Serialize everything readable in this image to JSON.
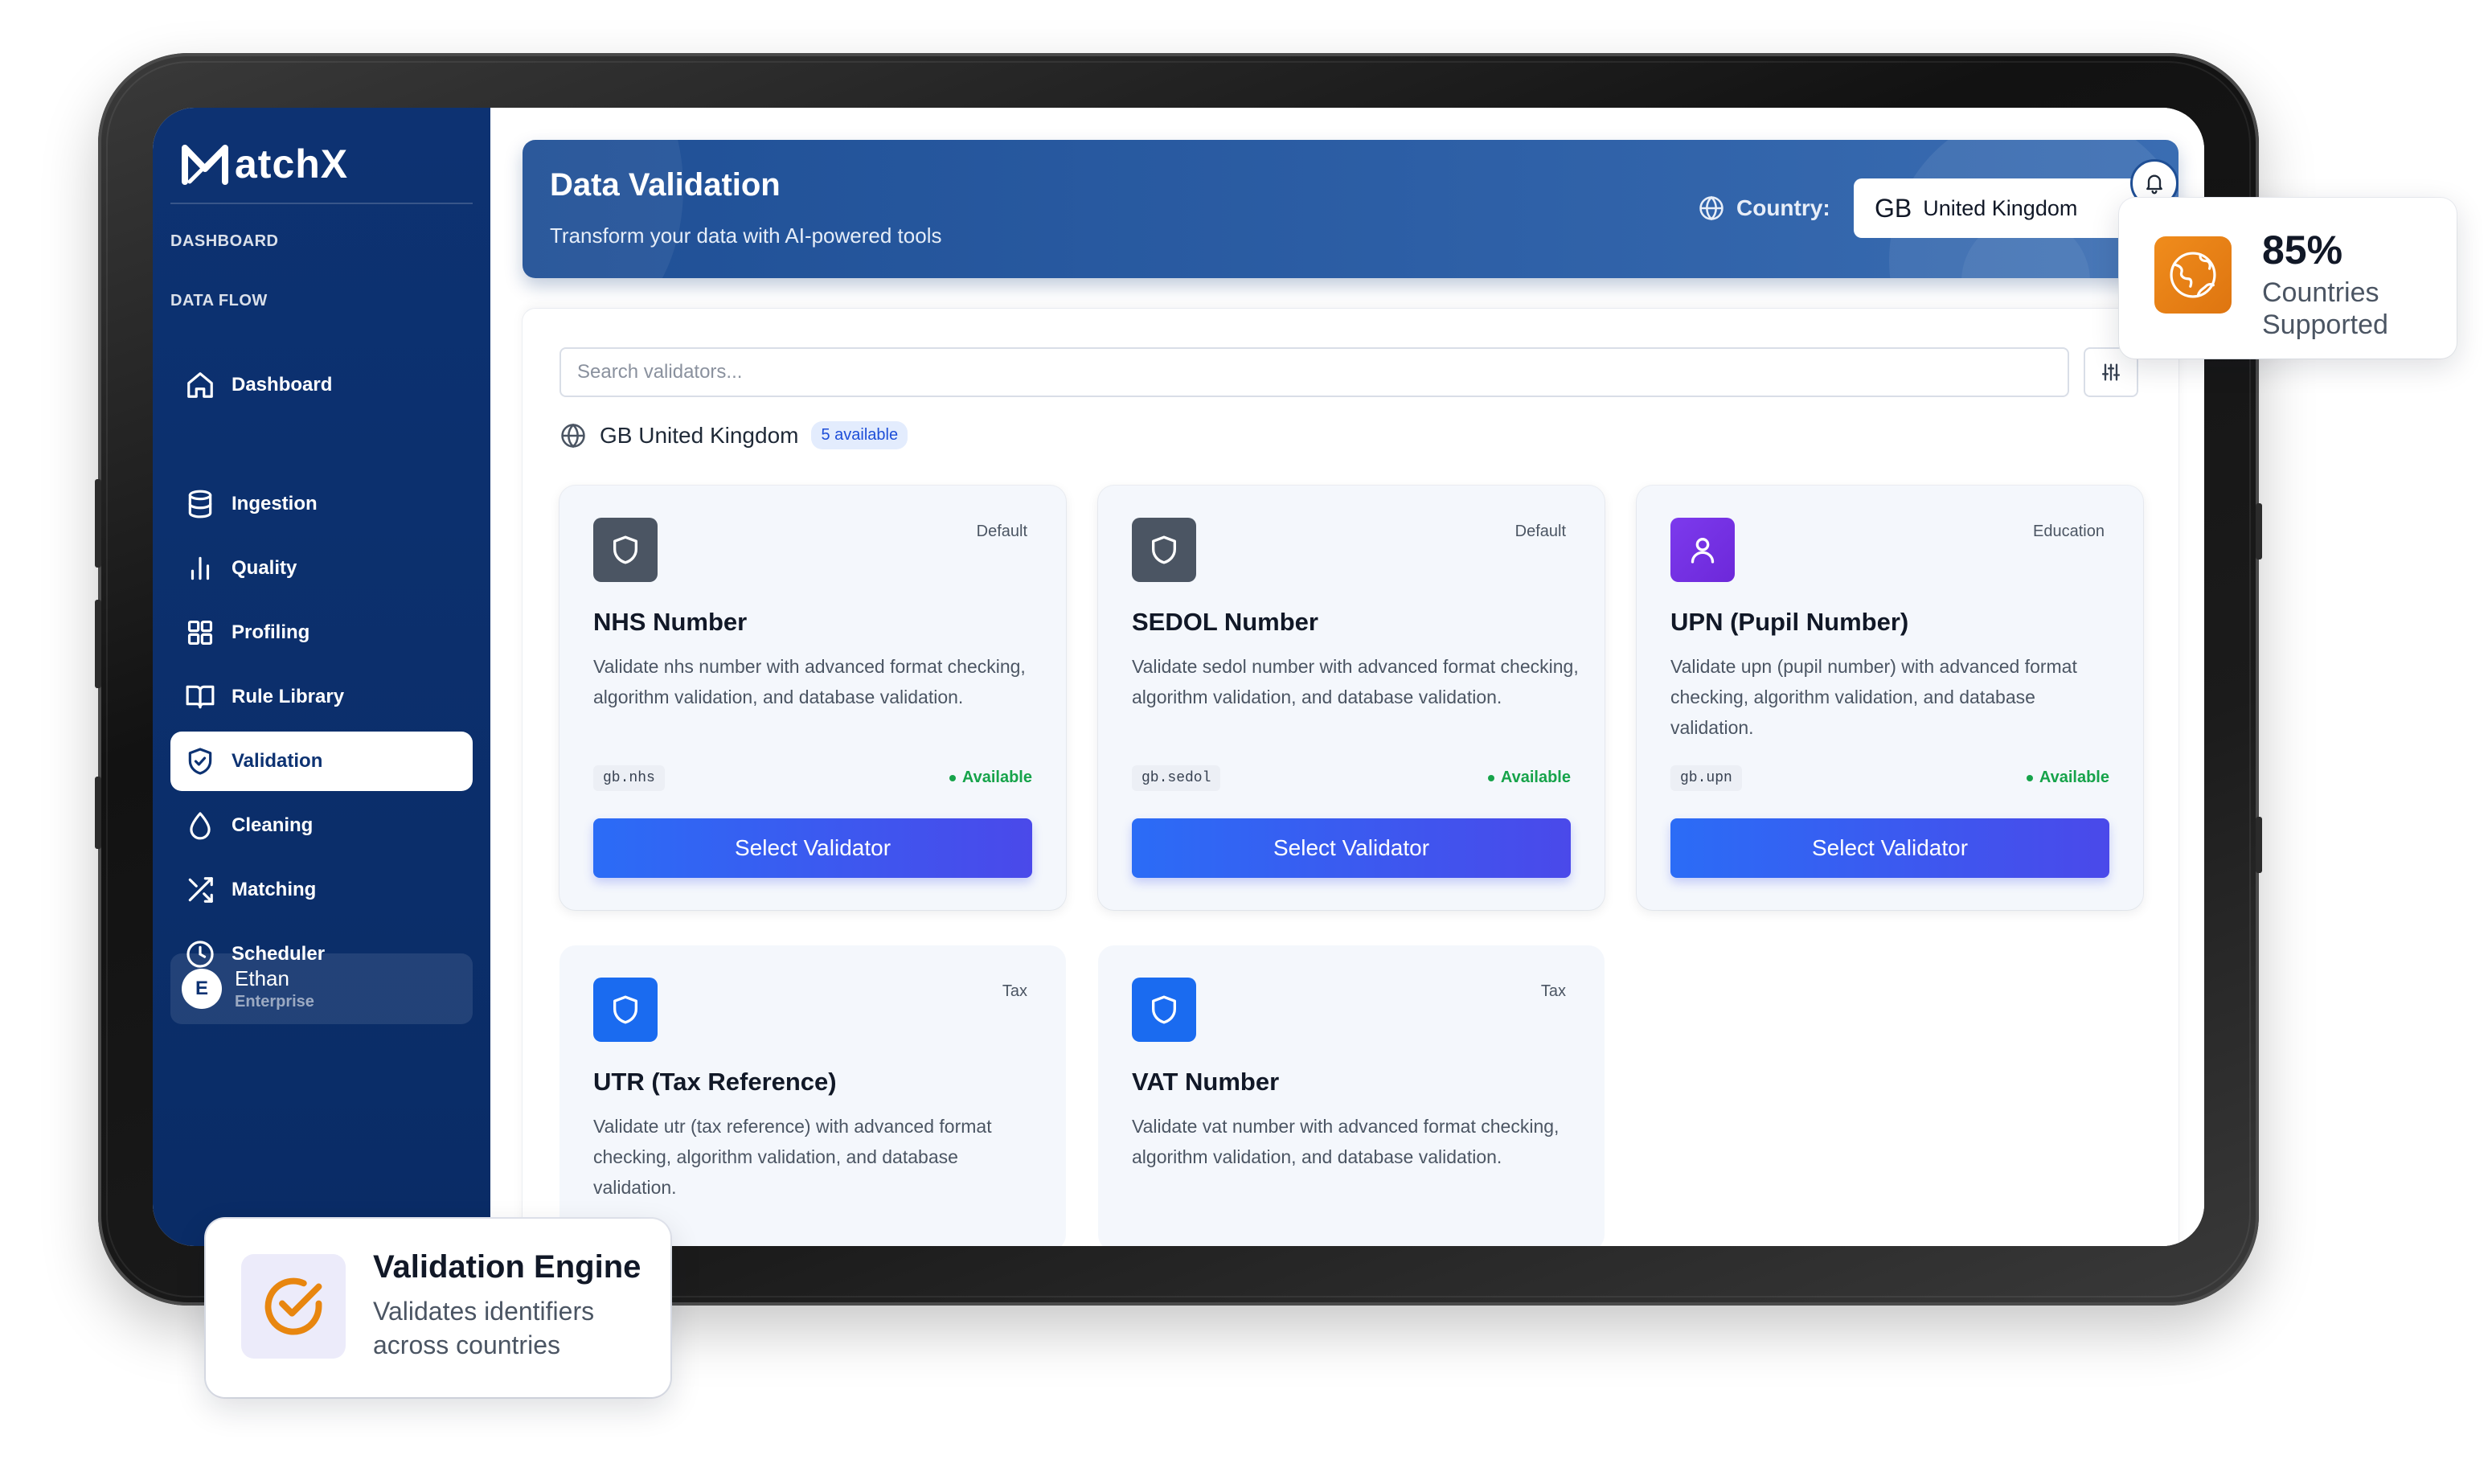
{
  "app": {
    "logo_text": "atchX",
    "brand_color": "#0d3272",
    "accent_color": "#2b6cf6"
  },
  "sidebar": {
    "sections": [
      {
        "label": "DASHBOARD"
      },
      {
        "label": "DATA FLOW"
      }
    ],
    "items": [
      {
        "label": "Dashboard",
        "icon": "home-icon"
      },
      {
        "label": "Ingestion",
        "icon": "database-icon"
      },
      {
        "label": "Quality",
        "icon": "bar-chart-icon"
      },
      {
        "label": "Profiling",
        "icon": "grid-icon"
      },
      {
        "label": "Rule Library",
        "icon": "book-icon"
      },
      {
        "label": "Validation",
        "icon": "shield-check-icon",
        "active": true
      },
      {
        "label": "Cleaning",
        "icon": "droplet-icon"
      },
      {
        "label": "Matching",
        "icon": "shuffle-icon"
      },
      {
        "label": "Scheduler",
        "icon": "clock-icon"
      }
    ],
    "user": {
      "initial": "E",
      "name": "Ethan",
      "plan": "Enterprise"
    }
  },
  "header": {
    "title": "Data Validation",
    "subtitle": "Transform your data with AI-powered tools",
    "country_label": "Country:",
    "country_code": "GB",
    "country_name": "United Kingdom"
  },
  "search": {
    "placeholder": "Search validators..."
  },
  "region": {
    "name": "GB United Kingdom",
    "badge": "5 available"
  },
  "validators": [
    {
      "category": "Default",
      "title": "NHS Number",
      "description": "Validate nhs number with advanced format checking, algorithm validation, and database validation.",
      "code": "gb.nhs",
      "status": "Available",
      "button": "Select Validator",
      "icon": "shield-icon"
    },
    {
      "category": "Default",
      "title": "SEDOL Number",
      "description": "Validate sedol number with advanced format checking, algorithm validation, and database validation.",
      "code": "gb.sedol",
      "status": "Available",
      "button": "Select Validator",
      "icon": "shield-icon"
    },
    {
      "category": "Education",
      "title": "UPN (Pupil Number)",
      "description": "Validate upn (pupil number) with advanced format checking, algorithm validation, and database validation.",
      "code": "gb.upn",
      "status": "Available",
      "button": "Select Validator",
      "icon": "user-icon"
    },
    {
      "category": "Tax",
      "title": "UTR (Tax Reference)",
      "description": "Validate utr (tax reference) with advanced format checking, algorithm validation, and database validation.",
      "icon": "shield-icon"
    },
    {
      "category": "Tax",
      "title": "VAT Number",
      "description": "Validate vat number with advanced format checking, algorithm validation, and database validation.",
      "icon": "shield-icon"
    }
  ],
  "stats_card": {
    "value": "85%",
    "label": "Countries Supported",
    "icon": "globe-icon",
    "color": "#f08c1c"
  },
  "engine_card": {
    "title": "Validation Engine",
    "subtitle": "Validates identifiers across countries",
    "icon": "check-circle-icon"
  }
}
